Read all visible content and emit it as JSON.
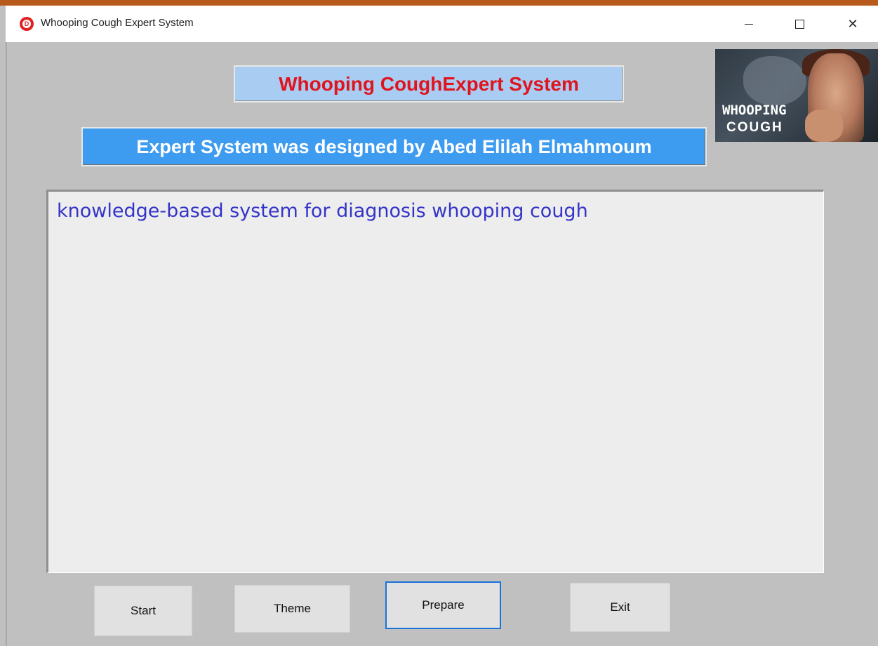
{
  "window": {
    "title": "Whooping Cough Expert System",
    "icon": "red-circle-app-icon",
    "controls": [
      "minimize",
      "maximize",
      "close"
    ]
  },
  "header": {
    "title": "Whooping CoughExpert System",
    "title_color": "#e0141e",
    "title_bg": "#a9cdf2",
    "subtitle": "Expert System was designed by Abed Elilah Elmahmoum",
    "subtitle_bg": "#3d9bf0"
  },
  "logo": {
    "line1": "WHOOPING",
    "line2": "COUGH"
  },
  "main": {
    "text": "knowledge-based system for diagnosis whooping cough",
    "text_color": "#3434c8"
  },
  "buttons": {
    "start": "Start",
    "theme": "Theme",
    "prepare": "Prepare",
    "exit": "Exit"
  },
  "colors": {
    "background": "#c0c0c0",
    "accent_border": "#1a73d9"
  }
}
